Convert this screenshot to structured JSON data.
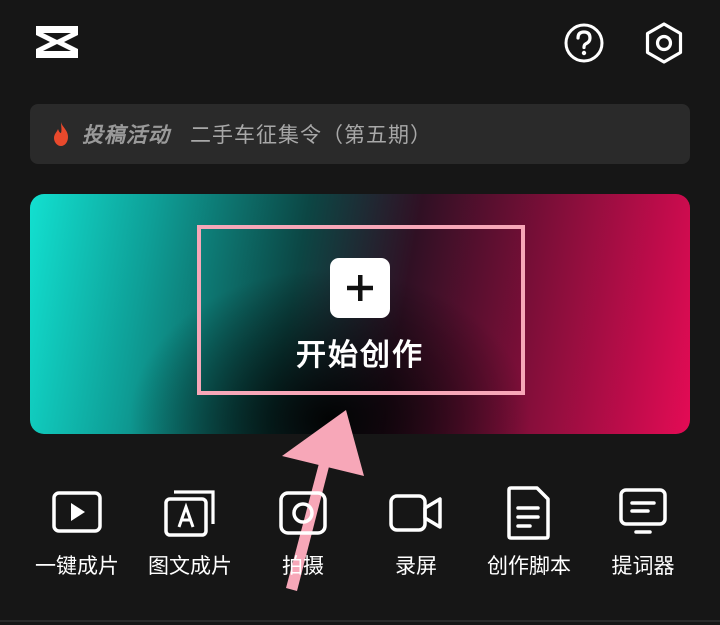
{
  "banner": {
    "tag": "投稿活动",
    "title": "二手车征集令（第五期）"
  },
  "create": {
    "label": "开始创作"
  },
  "tools": [
    {
      "label": "一键成片",
      "icon": "play-icon"
    },
    {
      "label": "图文成片",
      "icon": "image-text-icon"
    },
    {
      "label": "拍摄",
      "icon": "camera-icon"
    },
    {
      "label": "录屏",
      "icon": "video-camera-icon"
    },
    {
      "label": "创作脚本",
      "icon": "script-doc-icon"
    },
    {
      "label": "提词器",
      "icon": "teleprompter-icon"
    }
  ],
  "colors": {
    "background": "#161616",
    "banner_bg": "#2a2a2a",
    "gradient_left": "#12e0d0",
    "gradient_right": "#e40b55",
    "highlight": "#f7a7b8",
    "fire": "#e8492c"
  }
}
